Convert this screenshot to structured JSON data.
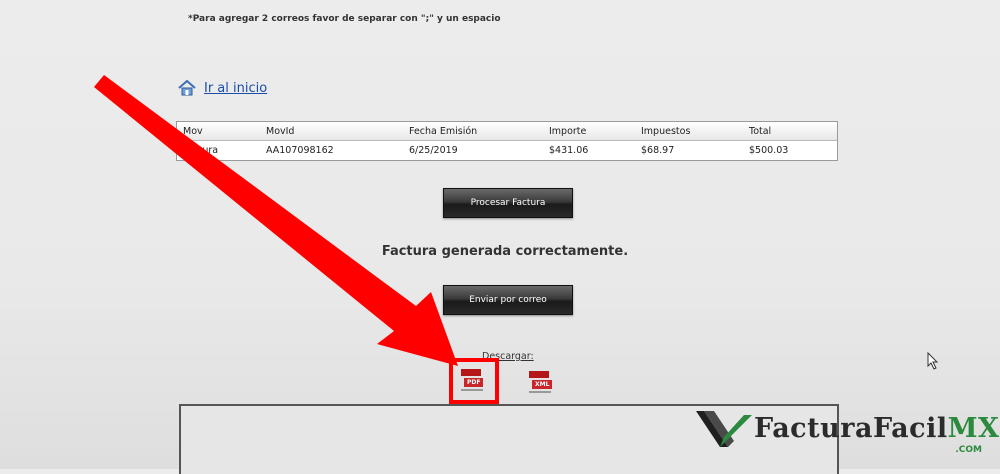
{
  "note": "*Para agregar 2 correos favor de separar con \";\" y un espacio",
  "home_link": "Ir al inicio",
  "table": {
    "headers": [
      "Mov",
      "MovId",
      "Fecha Emisión",
      "Importe",
      "Impuestos",
      "Total"
    ],
    "row": [
      "Factura",
      "AA107098162",
      "6/25/2019",
      "$431.06",
      "$68.97",
      "$500.03"
    ]
  },
  "buttons": {
    "procesar": "Procesar Factura",
    "enviar": "Enviar por correo"
  },
  "status": "Factura generada correctamente.",
  "download": {
    "label": "Descargar:",
    "pdf": "PDF",
    "xml": "XML"
  },
  "brand": {
    "name": "FacturaFacil",
    "suffix": "MX",
    "sub": ".COM"
  },
  "colors": {
    "arrow": "#ff0000",
    "highlight": "#ff0000",
    "link": "#1a4ea8",
    "brand_green": "#2b8a3e"
  }
}
